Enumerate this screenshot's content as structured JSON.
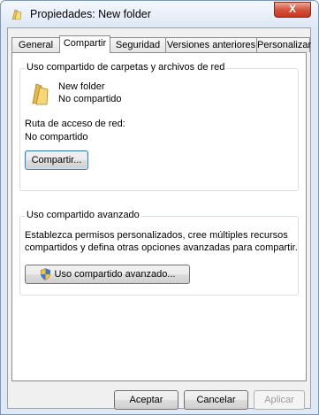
{
  "window": {
    "title": "Propiedades: New folder",
    "close_glyph": "X"
  },
  "tabs": [
    {
      "label": "General"
    },
    {
      "label": "Compartir"
    },
    {
      "label": "Seguridad"
    },
    {
      "label": "Versiones anteriores"
    },
    {
      "label": "Personalizar"
    }
  ],
  "network_sharing": {
    "group_label": "Uso compartido de carpetas y archivos de red",
    "folder_name": "New folder",
    "folder_status": "No compartido",
    "path_label": "Ruta de acceso de red:",
    "path_value": "No compartido",
    "share_button": "Compartir..."
  },
  "advanced_sharing": {
    "group_label": "Uso compartido avanzado",
    "description_line1": "Establezca permisos personalizados, cree múltiples recursos",
    "description_line2": "compartidos y defina otras opciones avanzadas para compartir.",
    "button": "Uso compartido avanzado..."
  },
  "footer": {
    "ok": "Aceptar",
    "cancel": "Cancelar",
    "apply": "Aplicar"
  },
  "icons": {
    "title": "folder-icon",
    "folder": "folder-icon",
    "shield": "uac-shield-icon"
  }
}
